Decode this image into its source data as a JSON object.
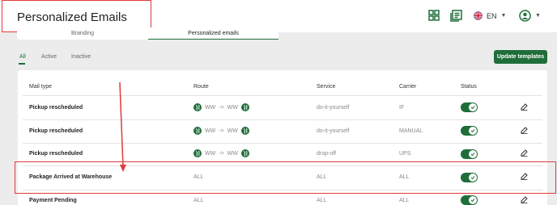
{
  "header": {
    "title": "Personalized Emails",
    "language": "EN"
  },
  "tabs": {
    "branding": "Branding",
    "personalized": "Personalized emails"
  },
  "filters": [
    "All",
    "Active",
    "Inactive"
  ],
  "actions": {
    "update_templates": "Update templates"
  },
  "table": {
    "headers": {
      "mail_type": "Mail type",
      "route": "Route",
      "service": "Service",
      "carrier": "Carrier",
      "status": "Status"
    },
    "rows": [
      {
        "mail_type": "Pickup rescheduled",
        "route_from": "WW",
        "route_sep": "->",
        "route_to": "WW",
        "service": "do-it-yourself",
        "carrier": "IF"
      },
      {
        "mail_type": "Pickup rescheduled",
        "route_from": "WW",
        "route_sep": "->",
        "route_to": "WW",
        "service": "do-it-yourself",
        "carrier": "MANUAL"
      },
      {
        "mail_type": "Pickup rescheduled",
        "route_from": "WW",
        "route_sep": "->",
        "route_to": "WW",
        "service": "drop-off",
        "carrier": "UPS"
      },
      {
        "mail_type": "Package Arrived at Warehouse",
        "route": "ALL",
        "service": "ALL",
        "carrier": "ALL"
      },
      {
        "mail_type": "Payment Pending",
        "route": "ALL",
        "service": "ALL",
        "carrier": "ALL"
      }
    ]
  },
  "colors": {
    "brand_green": "#1f6e3a",
    "annotation_red": "#e03a3a"
  },
  "icons": [
    "dashboard-icon",
    "document-list-icon",
    "uk-flag-icon",
    "user-avatar-icon",
    "globe-icon",
    "edit-icon",
    "check-icon"
  ]
}
